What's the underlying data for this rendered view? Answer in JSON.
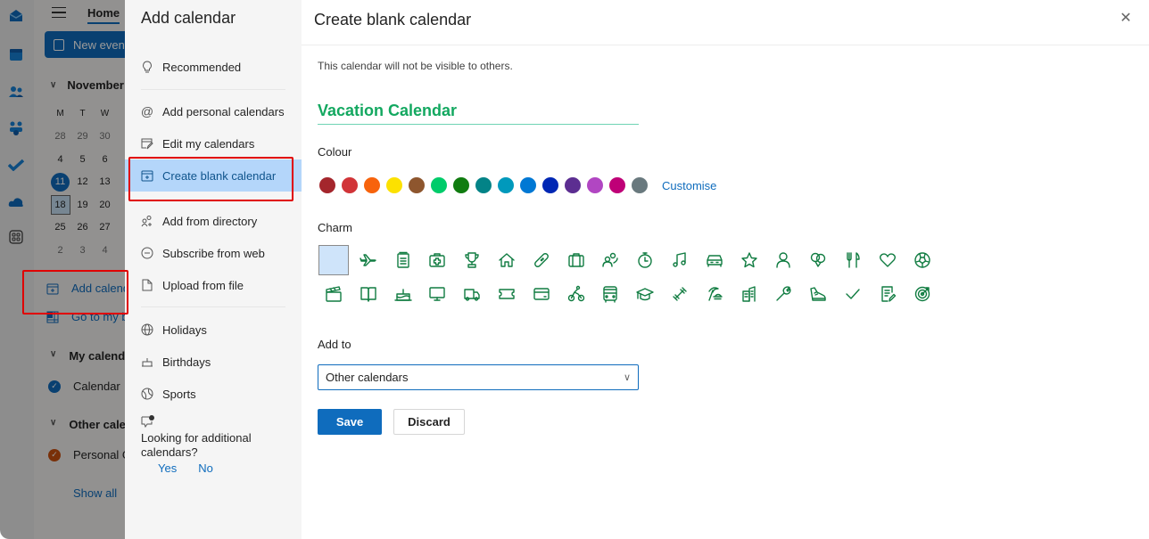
{
  "background_app": {
    "home_tab": "Home",
    "new_event_label": "New event",
    "month_label": "November",
    "weekday_headers": [
      "M",
      "T",
      "W"
    ],
    "weeks": [
      [
        {
          "d": "28",
          "s": "dim"
        },
        {
          "d": "29",
          "s": "dim"
        },
        {
          "d": "30",
          "s": "dim"
        }
      ],
      [
        {
          "d": "4",
          "s": ""
        },
        {
          "d": "5",
          "s": ""
        },
        {
          "d": "6",
          "s": ""
        }
      ],
      [
        {
          "d": "11",
          "s": "today"
        },
        {
          "d": "12",
          "s": ""
        },
        {
          "d": "13",
          "s": ""
        }
      ],
      [
        {
          "d": "18",
          "s": "sel"
        },
        {
          "d": "19",
          "s": ""
        },
        {
          "d": "20",
          "s": ""
        }
      ],
      [
        {
          "d": "25",
          "s": ""
        },
        {
          "d": "26",
          "s": ""
        },
        {
          "d": "27",
          "s": ""
        }
      ],
      [
        {
          "d": "2",
          "s": "dim"
        },
        {
          "d": "3",
          "s": "dim"
        },
        {
          "d": "4",
          "s": "dim"
        }
      ]
    ],
    "add_calendar_link": "Add calendar",
    "go_to_link": "Go to my booking page",
    "my_calendars_header": "My calendars",
    "calendar_item": "Calendar",
    "other_calendars_header": "Other calendars",
    "personal_item": "Personal Goals",
    "show_all": "Show all",
    "rail_icons": [
      "mail-icon",
      "calendar-icon",
      "people-icon",
      "teams-icon",
      "todo-check-icon",
      "onedrive-cloud-icon",
      "apps-grid-icon"
    ]
  },
  "side_panel": {
    "title": "Add calendar",
    "items": [
      {
        "label": "Recommended",
        "icon": "lightbulb-icon"
      },
      {
        "label": "Add personal calendars",
        "icon": "at-sign-icon"
      },
      {
        "label": "Edit my calendars",
        "icon": "edit-calendar-icon"
      },
      {
        "label": "Create blank calendar",
        "icon": "calendar-add-icon",
        "active": true
      },
      {
        "label": "Add from directory",
        "icon": "people-add-icon"
      },
      {
        "label": "Subscribe from web",
        "icon": "link-circle-icon"
      },
      {
        "label": "Upload from file",
        "icon": "document-add-icon"
      },
      {
        "label": "Holidays",
        "icon": "globe-icon"
      },
      {
        "label": "Birthdays",
        "icon": "cake-icon"
      },
      {
        "label": "Sports",
        "icon": "basketball-icon"
      }
    ],
    "feedback_text": "Looking for additional calendars?",
    "feedback_yes": "Yes",
    "feedback_no": "No"
  },
  "content": {
    "title": "Create blank calendar",
    "subtitle": "This calendar will not be visible to others.",
    "name_value": "Vacation Calendar",
    "colour_label": "Colour",
    "colours": [
      "#a4262c",
      "#d13438",
      "#f7630c",
      "#fce100",
      "#8e562e",
      "#00cc6a",
      "#107c10",
      "#038387",
      "#0099bc",
      "#0078d4",
      "#0027b4",
      "#5c2e91",
      "#b146c2",
      "#bf0077",
      "#69797e"
    ],
    "customise_label": "Customise",
    "charm_label": "Charm",
    "charms": [
      "none",
      "airplane",
      "notepad",
      "medical-kit",
      "trophy",
      "home",
      "bandage",
      "briefcase",
      "people",
      "stopwatch",
      "music-note",
      "car",
      "star",
      "person",
      "balloons",
      "fork-knife",
      "heart",
      "soccer-ball",
      "clapperboard",
      "book",
      "birthday-cake",
      "monitor",
      "truck",
      "ticket",
      "credit-card",
      "cyclist",
      "bus",
      "graduation-cap",
      "dumbbell",
      "beach",
      "building",
      "wrench",
      "sneaker",
      "checkmark",
      "notes-edit",
      "target"
    ],
    "add_to_label": "Add to",
    "add_to_value": "Other calendars",
    "save_label": "Save",
    "discard_label": "Discard"
  }
}
